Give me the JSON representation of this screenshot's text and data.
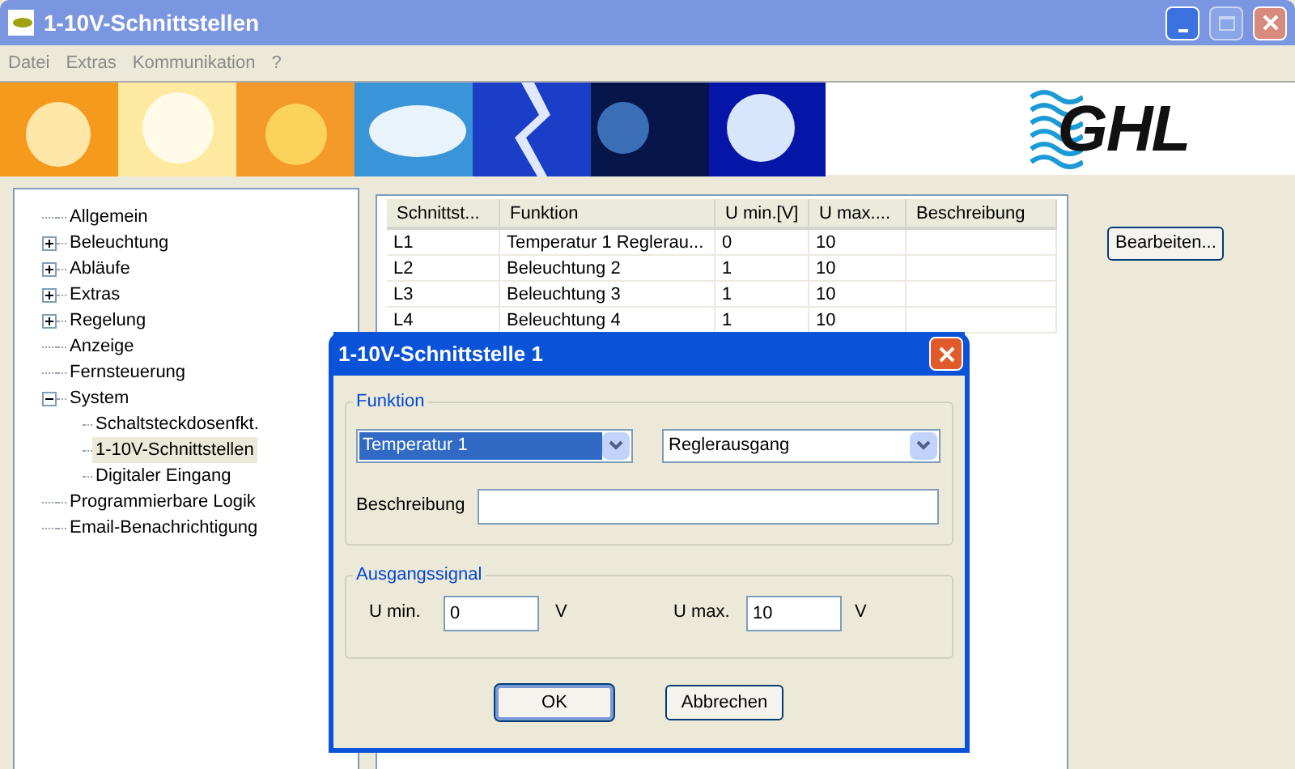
{
  "window": {
    "title": "1-10V-Schnittstellen",
    "active": false
  },
  "menu": [
    {
      "label": "Datei"
    },
    {
      "label": "Extras"
    },
    {
      "label": "Kommunikation"
    },
    {
      "label": "?"
    }
  ],
  "banner": {
    "logo": "GHL"
  },
  "tree": [
    {
      "label": "Allgemein"
    },
    {
      "label": "Beleuchtung",
      "expanded": false
    },
    {
      "label": "Abläufe",
      "expanded": false
    },
    {
      "label": "Extras",
      "expanded": false
    },
    {
      "label": "Regelung",
      "expanded": false
    },
    {
      "label": "Anzeige"
    },
    {
      "label": "Fernsteuerung"
    },
    {
      "label": "System",
      "expanded": true,
      "children": [
        {
          "label": "Schaltsteckdosenfkt.",
          "selected": false
        },
        {
          "label": "1-10V-Schnittstellen",
          "selected": true
        },
        {
          "label": "Digitaler Eingang",
          "selected": false
        }
      ]
    },
    {
      "label": "Programmierbare Logik"
    },
    {
      "label": "Email-Benachrichtigung"
    }
  ],
  "table": {
    "columns": [
      "Schnittst...",
      "Funktion",
      "U min.[V]",
      "U max....",
      "Beschreibung"
    ],
    "rows": [
      [
        "L1",
        "Temperatur 1 Reglerau...",
        "0",
        "10",
        ""
      ],
      [
        "L2",
        "Beleuchtung 2",
        "1",
        "10",
        ""
      ],
      [
        "L3",
        "Beleuchtung 3",
        "1",
        "10",
        ""
      ],
      [
        "L4",
        "Beleuchtung 4",
        "1",
        "10",
        ""
      ]
    ]
  },
  "edit_button": "Bearbeiten...",
  "dialog": {
    "title": "1-10V-Schnittstelle 1",
    "active": true,
    "function_group": "Funktion",
    "source": {
      "value": "Temperatur 1",
      "focused": true
    },
    "output": {
      "value": "Reglerausgang",
      "focused": false
    },
    "description_label": "Beschreibung",
    "signal_group": "Ausgangssignal",
    "umin_label": "U min.",
    "umin": "0",
    "umin_unit": "V",
    "umax_label": "U max.",
    "umax": "10",
    "umax_unit": "V",
    "ok": "OK",
    "cancel": "Abbrechen"
  }
}
